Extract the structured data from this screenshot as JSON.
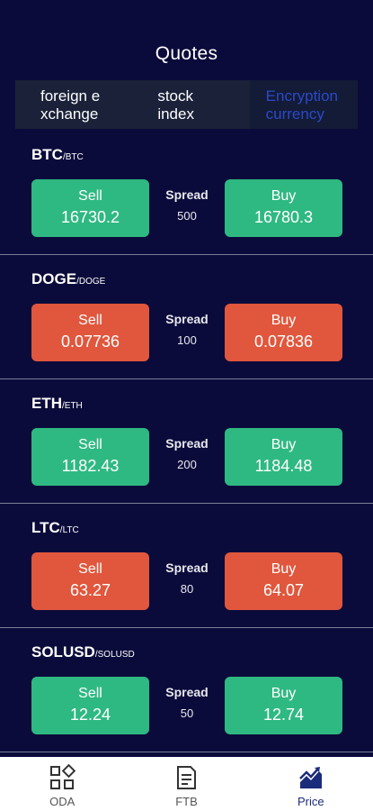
{
  "header": {
    "title": "Quotes"
  },
  "tabs": [
    {
      "label": "foreign e\nxchange"
    },
    {
      "label": "stock\nindex"
    },
    {
      "label": "Encryption\ncurrency"
    }
  ],
  "colors": {
    "background": "#0b0b3b",
    "up": "#2fb982",
    "down": "#e0573d",
    "active_tab": "#2c49c9"
  },
  "quotes": [
    {
      "symbol": "BTC",
      "sub": "/BTC",
      "sell_label": "Sell",
      "sell": "16730.2",
      "spread_label": "Spread",
      "spread": "500",
      "buy_label": "Buy",
      "buy": "16780.3",
      "color": "green"
    },
    {
      "symbol": "DOGE",
      "sub": "/DOGE",
      "sell_label": "Sell",
      "sell": "0.07736",
      "spread_label": "Spread",
      "spread": "100",
      "buy_label": "Buy",
      "buy": "0.07836",
      "color": "red"
    },
    {
      "symbol": "ETH",
      "sub": "/ETH",
      "sell_label": "Sell",
      "sell": "1182.43",
      "spread_label": "Spread",
      "spread": "200",
      "buy_label": "Buy",
      "buy": "1184.48",
      "color": "green"
    },
    {
      "symbol": "LTC",
      "sub": "/LTC",
      "sell_label": "Sell",
      "sell": "63.27",
      "spread_label": "Spread",
      "spread": "80",
      "buy_label": "Buy",
      "buy": "64.07",
      "color": "red"
    },
    {
      "symbol": "SOLUSD",
      "sub": "/SOLUSD",
      "sell_label": "Sell",
      "sell": "12.24",
      "spread_label": "Spread",
      "spread": "50",
      "buy_label": "Buy",
      "buy": "12.74",
      "color": "green"
    }
  ],
  "nav": [
    {
      "label": "ODA",
      "icon": "grid-icon"
    },
    {
      "label": "FTB",
      "icon": "document-icon"
    },
    {
      "label": "Price",
      "icon": "chart-icon"
    }
  ]
}
